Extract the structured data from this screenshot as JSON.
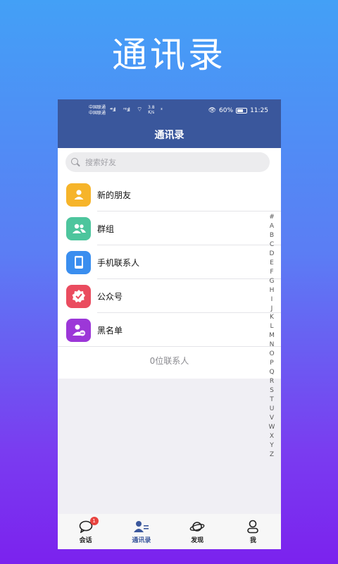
{
  "promo": {
    "title": "通讯录"
  },
  "statusbar": {
    "carrier_line1": "中国联通",
    "carrier_line2": "中国联通",
    "signal1": "⁴⁶.ıll",
    "signal2": "ᴴᴰ.ıll",
    "speed_value": "3.8",
    "speed_unit": "K/s",
    "battery_percent": "60%",
    "time": "11:25"
  },
  "header": {
    "title": "通讯录"
  },
  "search": {
    "placeholder": "搜索好友"
  },
  "menu": [
    {
      "label": "新的朋友",
      "color": "#f6b42a",
      "icon": "person-icon"
    },
    {
      "label": "群组",
      "color": "#4dc59d",
      "icon": "group-icon"
    },
    {
      "label": "手机联系人",
      "color": "#3a8eef",
      "icon": "phone-icon"
    },
    {
      "label": "公众号",
      "color": "#ea4c5f",
      "icon": "verified-badge-icon"
    },
    {
      "label": "黑名单",
      "color": "#9c37d8",
      "icon": "blocked-user-icon"
    }
  ],
  "contact_count": "0位联系人",
  "az_index": [
    "#",
    "A",
    "B",
    "C",
    "D",
    "E",
    "F",
    "G",
    "H",
    "I",
    "J",
    "K",
    "L",
    "M",
    "N",
    "O",
    "P",
    "Q",
    "R",
    "S",
    "T",
    "U",
    "V",
    "W",
    "X",
    "Y",
    "Z"
  ],
  "tabs": [
    {
      "label": "会话",
      "badge": "1"
    },
    {
      "label": "通讯录"
    },
    {
      "label": "发现"
    },
    {
      "label": "我"
    }
  ],
  "colors": {
    "header": "#3a579c",
    "badge": "#e8433f"
  }
}
